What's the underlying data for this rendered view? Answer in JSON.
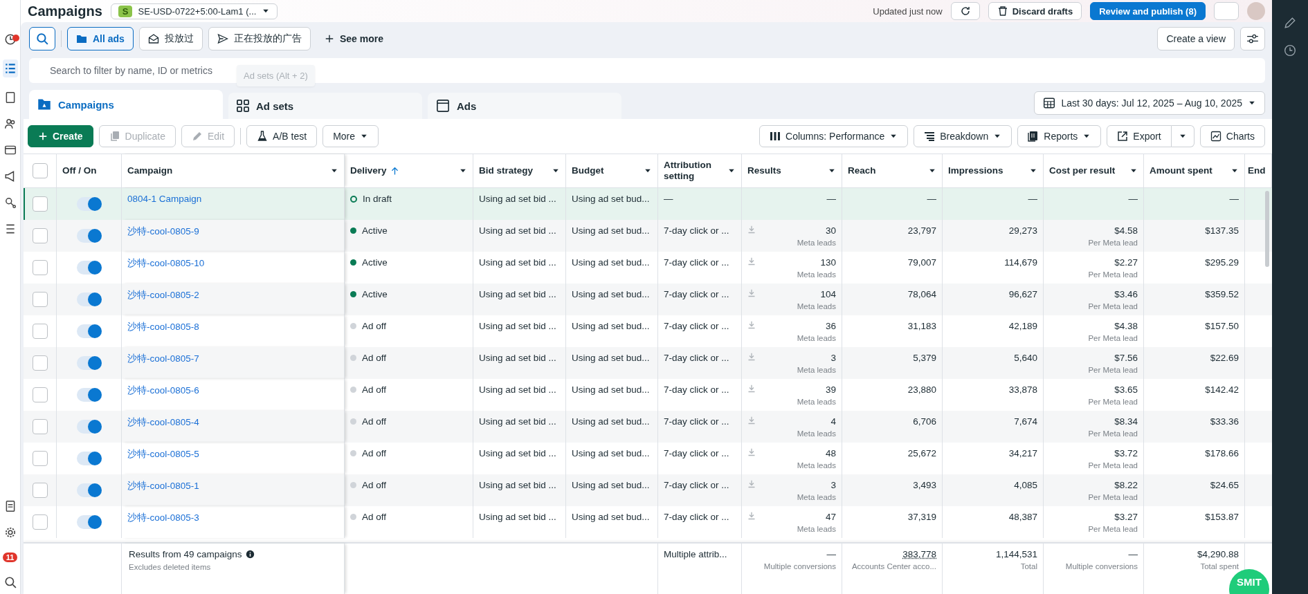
{
  "header": {
    "title": "Campaigns",
    "account_badge": "S",
    "account": "SE-USD-0722+5:00-Lam1 (...",
    "updated": "Updated just now",
    "discard": "Discard drafts",
    "publish": "Review and publish (8)"
  },
  "sidebar": {
    "badge": "11"
  },
  "filters": {
    "items": [
      {
        "label": "All ads",
        "selected": true
      },
      {
        "label": "投放过",
        "selected": false
      },
      {
        "label": "正在投放的广告",
        "selected": false
      }
    ],
    "see_more": "See more",
    "create_view": "Create a view"
  },
  "search": {
    "placeholder": "Search to filter by name, ID or metrics"
  },
  "tooltip": "Ad sets (Alt + 2)",
  "tabs": [
    {
      "label": "Campaigns",
      "selected": true
    },
    {
      "label": "Ad sets",
      "selected": false
    },
    {
      "label": "Ads",
      "selected": false
    }
  ],
  "date_range": "Last 30 days: Jul 12, 2025 – Aug 10, 2025",
  "actions": [
    {
      "label": "Create",
      "kind": "primary",
      "disabled": false
    },
    {
      "label": "Duplicate",
      "kind": "duplicate",
      "disabled": true
    },
    {
      "label": "Edit",
      "kind": "edit",
      "disabled": true
    },
    {
      "label": "A/B test",
      "kind": "abtest",
      "disabled": false
    }
  ],
  "more": "More",
  "view_buttons": [
    {
      "label": "Columns: Performance",
      "kind": "columns"
    },
    {
      "label": "Breakdown",
      "kind": "breakdown"
    },
    {
      "label": "Reports",
      "kind": "reports"
    },
    {
      "label": "Export",
      "kind": "export"
    },
    {
      "label": "Charts",
      "kind": "charts"
    }
  ],
  "table": {
    "select_all": {
      "checked": false
    },
    "columns": [
      {
        "label": "Off / On",
        "sorted": false
      },
      {
        "label": "Campaign",
        "sorted": false
      },
      {
        "label": "Delivery",
        "sorted": true
      },
      {
        "label": "Bid strategy",
        "sorted": false
      },
      {
        "label": "Budget",
        "sorted": false
      },
      {
        "label": "Attribution setting",
        "sorted": false
      },
      {
        "label": "Results",
        "sorted": false
      },
      {
        "label": "Reach",
        "sorted": false
      },
      {
        "label": "Impressions",
        "sorted": false
      },
      {
        "label": "Cost per result",
        "sorted": false
      },
      {
        "label": "Amount spent",
        "sorted": false
      },
      {
        "label": "End",
        "sorted": false
      }
    ],
    "rows": [
      {
        "highlighted": true,
        "checked": false,
        "on": true,
        "campaign": "0804-1 Campaign",
        "kind": "draft",
        "delivery": "In draft",
        "bid_strategy": "Using ad set bid ...",
        "budget": "Using ad set bud...",
        "attribution": "—",
        "results": "—",
        "reach": "—",
        "impressions": "—",
        "cost": "—",
        "spent": "—"
      },
      {
        "highlighted": false,
        "checked": false,
        "on": true,
        "campaign": "沙特-cool-0805-9",
        "kind": "active",
        "delivery": "Active",
        "bid_strategy": "Using ad set bid ...",
        "budget": "Using ad set bud...",
        "attribution": "7-day click or ...",
        "results": "30",
        "results_note": "Meta leads",
        "reach": "23,797",
        "impressions": "29,273",
        "cost": "$4.58",
        "cost_note": "Per Meta lead",
        "spent": "$137.35"
      },
      {
        "highlighted": false,
        "checked": false,
        "on": true,
        "campaign": "沙特-cool-0805-10",
        "kind": "active",
        "delivery": "Active",
        "bid_strategy": "Using ad set bid ...",
        "budget": "Using ad set bud...",
        "attribution": "7-day click or ...",
        "results": "130",
        "results_note": "Meta leads",
        "reach": "79,007",
        "impressions": "114,679",
        "cost": "$2.27",
        "cost_note": "Per Meta lead",
        "spent": "$295.29"
      },
      {
        "highlighted": false,
        "checked": false,
        "on": true,
        "campaign": "沙特-cool-0805-2",
        "kind": "active",
        "delivery": "Active",
        "bid_strategy": "Using ad set bid ...",
        "budget": "Using ad set bud...",
        "attribution": "7-day click or ...",
        "results": "104",
        "results_note": "Meta leads",
        "reach": "78,064",
        "impressions": "96,627",
        "cost": "$3.46",
        "cost_note": "Per Meta lead",
        "spent": "$359.52"
      },
      {
        "highlighted": false,
        "checked": false,
        "on": true,
        "campaign": "沙特-cool-0805-8",
        "kind": "off",
        "delivery": "Ad off",
        "bid_strategy": "Using ad set bid ...",
        "budget": "Using ad set bud...",
        "attribution": "7-day click or ...",
        "results": "36",
        "results_note": "Meta leads",
        "reach": "31,183",
        "impressions": "42,189",
        "cost": "$4.38",
        "cost_note": "Per Meta lead",
        "spent": "$157.50"
      },
      {
        "highlighted": false,
        "checked": false,
        "on": true,
        "campaign": "沙特-cool-0805-7",
        "kind": "off",
        "delivery": "Ad off",
        "bid_strategy": "Using ad set bid ...",
        "budget": "Using ad set bud...",
        "attribution": "7-day click or ...",
        "results": "3",
        "results_note": "Meta leads",
        "reach": "5,379",
        "impressions": "5,640",
        "cost": "$7.56",
        "cost_note": "Per Meta lead",
        "spent": "$22.69"
      },
      {
        "highlighted": false,
        "checked": false,
        "on": true,
        "campaign": "沙特-cool-0805-6",
        "kind": "off",
        "delivery": "Ad off",
        "bid_strategy": "Using ad set bid ...",
        "budget": "Using ad set bud...",
        "attribution": "7-day click or ...",
        "results": "39",
        "results_note": "Meta leads",
        "reach": "23,880",
        "impressions": "33,878",
        "cost": "$3.65",
        "cost_note": "Per Meta lead",
        "spent": "$142.42"
      },
      {
        "highlighted": false,
        "checked": false,
        "on": true,
        "campaign": "沙特-cool-0805-4",
        "kind": "off",
        "delivery": "Ad off",
        "bid_strategy": "Using ad set bid ...",
        "budget": "Using ad set bud...",
        "attribution": "7-day click or ...",
        "results": "4",
        "results_note": "Meta leads",
        "reach": "6,706",
        "impressions": "7,674",
        "cost": "$8.34",
        "cost_note": "Per Meta lead",
        "spent": "$33.36"
      },
      {
        "highlighted": false,
        "checked": false,
        "on": true,
        "campaign": "沙特-cool-0805-5",
        "kind": "off",
        "delivery": "Ad off",
        "bid_strategy": "Using ad set bid ...",
        "budget": "Using ad set bud...",
        "attribution": "7-day click or ...",
        "results": "48",
        "results_note": "Meta leads",
        "reach": "25,672",
        "impressions": "34,217",
        "cost": "$3.72",
        "cost_note": "Per Meta lead",
        "spent": "$178.66"
      },
      {
        "highlighted": false,
        "checked": false,
        "on": true,
        "campaign": "沙特-cool-0805-1",
        "kind": "off",
        "delivery": "Ad off",
        "bid_strategy": "Using ad set bid ...",
        "budget": "Using ad set bud...",
        "attribution": "7-day click or ...",
        "results": "3",
        "results_note": "Meta leads",
        "reach": "3,493",
        "impressions": "4,085",
        "cost": "$8.22",
        "cost_note": "Per Meta lead",
        "spent": "$24.65"
      },
      {
        "highlighted": false,
        "checked": false,
        "on": true,
        "campaign": "沙特-cool-0805-3",
        "kind": "off",
        "delivery": "Ad off",
        "bid_strategy": "Using ad set bid ...",
        "budget": "Using ad set bud...",
        "attribution": "7-day click or ...",
        "results": "47",
        "results_note": "Meta leads",
        "reach": "37,319",
        "impressions": "48,387",
        "cost": "$3.27",
        "cost_note": "Per Meta lead",
        "spent": "$153.87"
      }
    ],
    "footer": {
      "summary": "Results from 49 campaigns",
      "note": "Excludes deleted items",
      "attribution": "Multiple attrib...",
      "cells": [
        {
          "value": "—",
          "note": "Multiple conversions",
          "dotted": false
        },
        {
          "value": "383,778",
          "note": "Accounts Center acco...",
          "dotted": true
        },
        {
          "value": "1,144,531",
          "note": "Total",
          "dotted": false
        },
        {
          "value": "—",
          "note": "Multiple conversions",
          "dotted": false
        },
        {
          "value": "$4,290.88",
          "note": "Total spent",
          "dotted": false
        }
      ]
    }
  },
  "floating_badge": "SMIT"
}
